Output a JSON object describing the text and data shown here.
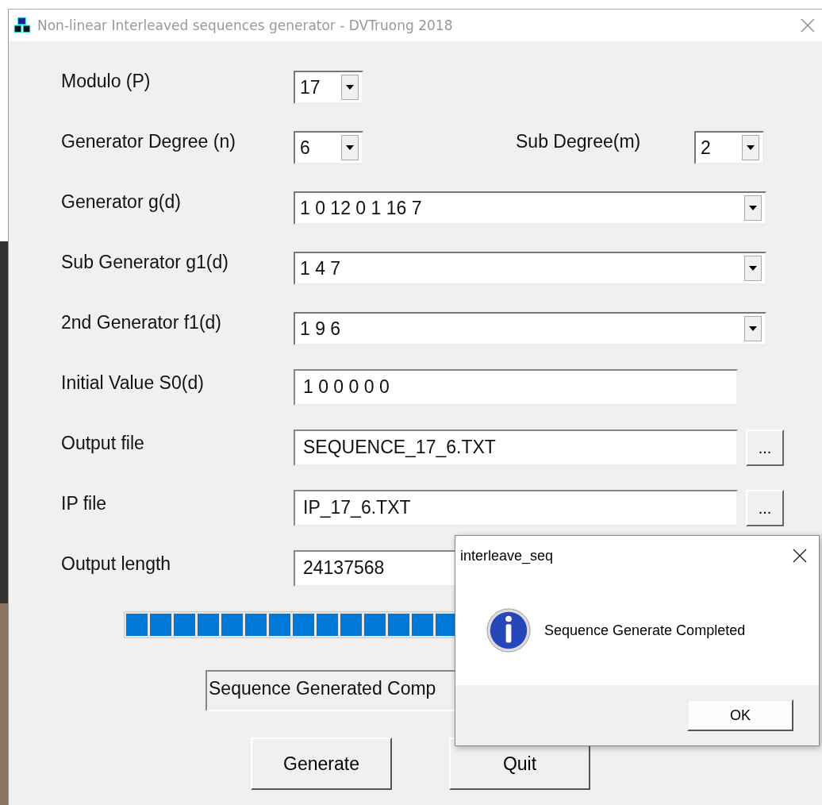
{
  "window": {
    "title": "Non-linear Interleaved sequences generator - DVTruong 2018"
  },
  "fields": [
    {
      "kind": "small_combo",
      "label": "Modulo (P)",
      "value": "17"
    },
    {
      "kind": "small_combo",
      "label": "Generator Degree (n)",
      "value": "6",
      "side": {
        "label": "Sub Degree(m)",
        "value": "2"
      }
    },
    {
      "kind": "combo",
      "label": "Generator g(d)",
      "value": "1 0 12 0 1 16 7"
    },
    {
      "kind": "combo",
      "label": "Sub Generator g1(d)",
      "value": "1 4 7"
    },
    {
      "kind": "combo",
      "label": "2nd Generator f1(d)",
      "value": "1 9 6"
    },
    {
      "kind": "text",
      "label": "Initial Value S0(d)",
      "value": "1 0 0 0 0 0"
    },
    {
      "kind": "file",
      "label": "Output file",
      "value": "SEQUENCE_17_6.TXT",
      "browse": "..."
    },
    {
      "kind": "file",
      "label": "IP file",
      "value": "IP_17_6.TXT",
      "browse": "..."
    },
    {
      "kind": "text",
      "label": "Output length",
      "value": "24137568"
    }
  ],
  "progress": {
    "level": 1
  },
  "status": {
    "text": "Sequence Generated Comp"
  },
  "buttons": [
    {
      "label": "Generate"
    },
    {
      "label": "Quit"
    }
  ],
  "dialog": {
    "title": "interleave_seq",
    "message": "Sequence Generate Completed",
    "button": "OK"
  }
}
